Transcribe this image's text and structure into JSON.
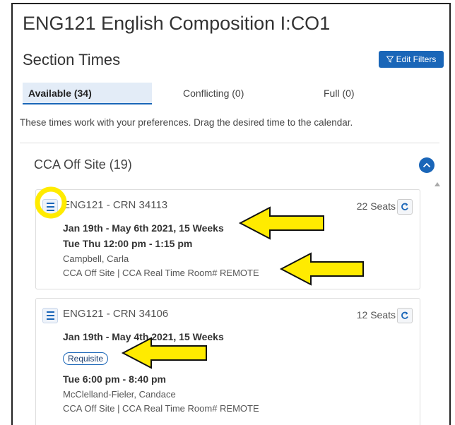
{
  "header": {
    "course_title": "ENG121 English Composition I:CO1",
    "section_title": "Section Times",
    "edit_filters_label": "Edit Filters"
  },
  "tabs": [
    {
      "label": "Available (34)",
      "active": true
    },
    {
      "label": "Conflicting (0)",
      "active": false
    },
    {
      "label": "Full (0)",
      "active": false
    }
  ],
  "hint": "These times work with your preferences. Drag the desired time to the calendar.",
  "group": {
    "label": "CCA Off Site (19)",
    "expanded": true
  },
  "sections": [
    {
      "title": "ENG121 - CRN 34113",
      "seats": "22 Seats",
      "dates": "Jan 19th - May 6th 2021, 15 Weeks",
      "time": "Tue Thu 12:00 pm - 1:15 pm",
      "instructor": "Campbell, Carla",
      "location": "CCA Off Site | CCA Real Time Room# REMOTE"
    },
    {
      "title": "ENG121 - CRN 34106",
      "seats": "12 Seats",
      "dates": "Jan 19th - May 4th 2021, 15 Weeks",
      "badge": "Requisite",
      "time": "Tue 6:00 pm - 8:40 pm",
      "instructor": "McClelland-Fieler, Candace",
      "location": "CCA Off Site | CCA Real Time Room# REMOTE"
    }
  ],
  "colors": {
    "accent": "#1a66b8",
    "annotation_yellow": "#ffeb00",
    "active_tab_bg": "#e3ecf7"
  }
}
